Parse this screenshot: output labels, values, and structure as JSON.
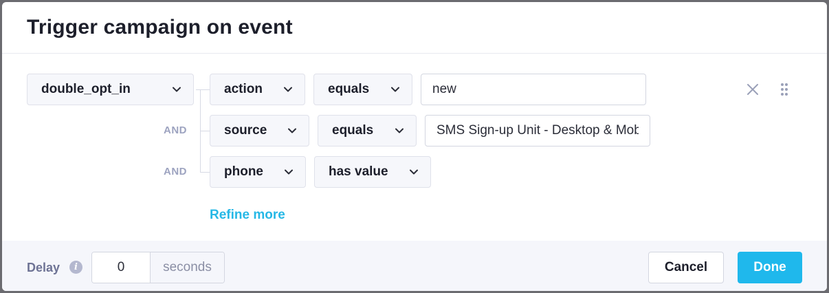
{
  "modal": {
    "title": "Trigger campaign on event"
  },
  "event": {
    "name": "double_opt_in"
  },
  "conditions": [
    {
      "connector": "",
      "field": "action",
      "operator": "equals",
      "value": "new"
    },
    {
      "connector": "AND",
      "field": "source",
      "operator": "equals",
      "value": "SMS Sign-up Unit - Desktop & Mobile"
    },
    {
      "connector": "AND",
      "field": "phone",
      "operator": "has value"
    }
  ],
  "refine_label": "Refine more",
  "icons": {
    "remove": "close-icon",
    "drag": "drag-handle-icon",
    "dropdown": "chevron-down-icon",
    "info": "info-icon"
  },
  "footer": {
    "delay_label": "Delay",
    "info_glyph": "i",
    "delay_value": "0",
    "delay_unit": "seconds",
    "cancel_label": "Cancel",
    "done_label": "Done"
  },
  "colors": {
    "accent": "#1fb8ec",
    "and_label": "#9da3c0",
    "text": "#1d1f2b"
  }
}
